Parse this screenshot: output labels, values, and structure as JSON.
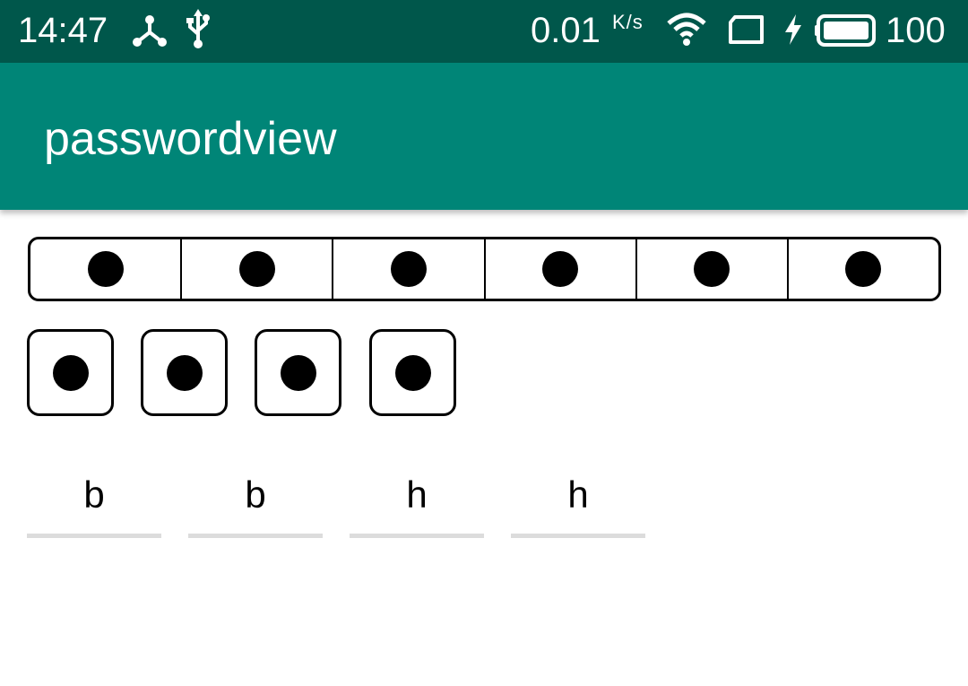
{
  "status_bar": {
    "time": "14:47",
    "net_speed": "0.01",
    "net_speed_unit": "K/s",
    "battery": "100",
    "icons": [
      "share-icon",
      "usb-icon",
      "wifi-icon",
      "sim-icon",
      "charging-icon",
      "battery-icon"
    ]
  },
  "app_bar": {
    "title": "passwordview"
  },
  "password_views": {
    "connected": {
      "length": 6,
      "filled": 6
    },
    "boxes": {
      "length": 4,
      "filled": 4
    },
    "underline": {
      "chars": [
        "b",
        "b",
        "h",
        "h"
      ]
    }
  },
  "colors": {
    "status_bar": "#00574b",
    "app_bar": "#008577",
    "underline": "#dcdcdc"
  }
}
